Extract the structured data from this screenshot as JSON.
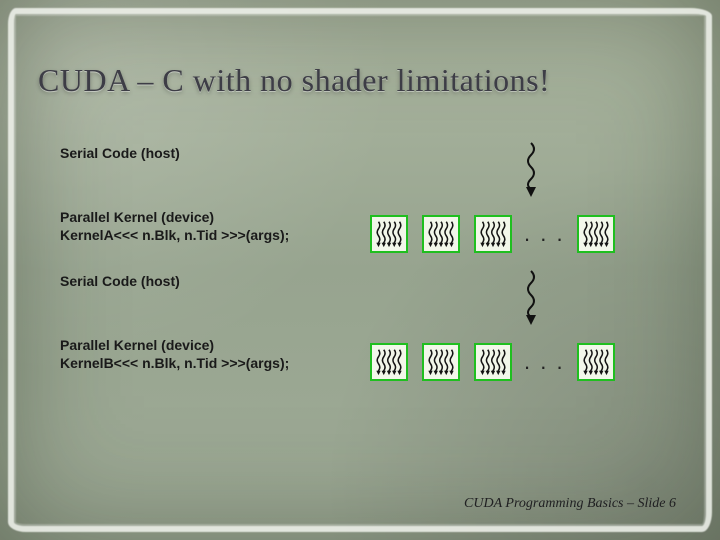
{
  "title": "CUDA – C with no shader limitations!",
  "rows": [
    {
      "id": "serial1",
      "type": "serial",
      "label": "Serial Code (host)"
    },
    {
      "id": "kernelA",
      "type": "kernel",
      "label": "Parallel Kernel (device)",
      "code": "KernelA<<< n.Blk, n.Tid >>>(args);"
    },
    {
      "id": "serial2",
      "type": "serial",
      "label": "Serial Code (host)"
    },
    {
      "id": "kernelB",
      "type": "kernel",
      "label": "Parallel Kernel (device)",
      "code": "KernelB<<< n.Blk, n.Tid >>>(args);"
    }
  ],
  "ellipsis": ". . .",
  "blocks_per_row": {
    "before_ellipsis": 3,
    "after_ellipsis": 1
  },
  "threads_per_block": 5,
  "footer": "CUDA Programming Basics – Slide  6",
  "colors": {
    "block_border": "#1fbf1f",
    "block_fill": "#f2f7ea",
    "thread": "#141414"
  }
}
